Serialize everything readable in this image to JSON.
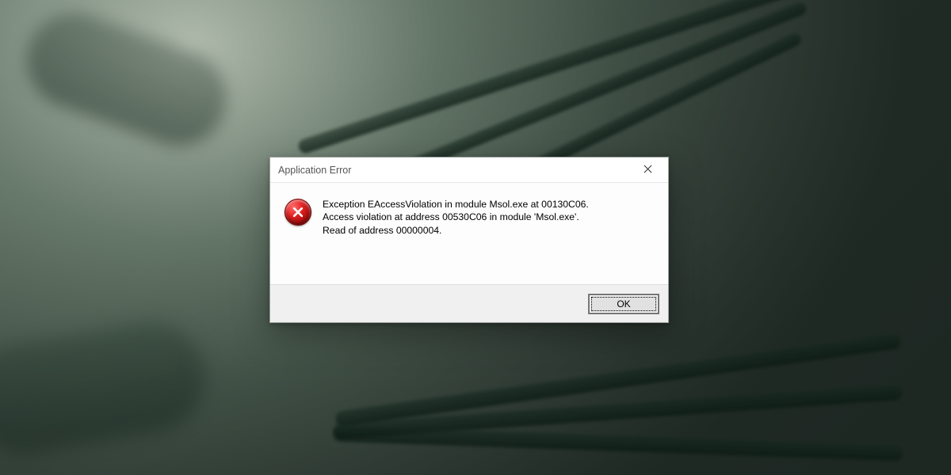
{
  "dialog": {
    "title": "Application Error",
    "message": "Exception EAccessViolation in module Msol.exe at 00130C06.\nAccess violation at address 00530C06 in module 'Msol.exe'.\nRead of address 00000004.",
    "ok_label": "OK"
  }
}
